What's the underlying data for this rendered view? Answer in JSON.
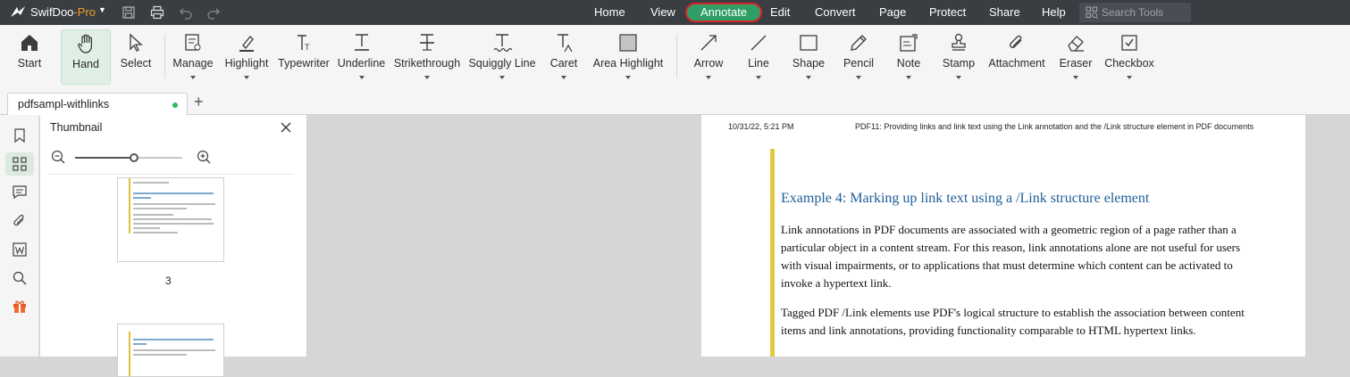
{
  "app": {
    "name": "SwifDoo",
    "edition": "-Pro"
  },
  "menu": {
    "items": [
      "Home",
      "View",
      "Annotate",
      "Edit",
      "Convert",
      "Page",
      "Protect",
      "Share",
      "Help"
    ],
    "active": "Annotate",
    "search_placeholder": "Search Tools"
  },
  "ribbon": {
    "tools": [
      {
        "label": "Start",
        "icon": "home-icon",
        "dropdown": false
      },
      {
        "label": "Hand",
        "icon": "hand-icon",
        "dropdown": false,
        "active": true
      },
      {
        "label": "Select",
        "icon": "cursor-icon",
        "dropdown": false
      },
      {
        "label": "Manage",
        "icon": "manage-icon",
        "dropdown": true
      },
      {
        "label": "Highlight",
        "icon": "highlighter-icon",
        "dropdown": true
      },
      {
        "label": "Typewriter",
        "icon": "typewriter-icon",
        "dropdown": false
      },
      {
        "label": "Underline",
        "icon": "underline-icon",
        "dropdown": true
      },
      {
        "label": "Strikethrough",
        "icon": "strikethrough-icon",
        "dropdown": true
      },
      {
        "label": "Squiggly Line",
        "icon": "squiggly-icon",
        "dropdown": true
      },
      {
        "label": "Caret",
        "icon": "caret-icon",
        "dropdown": true
      },
      {
        "label": "Area Highlight",
        "icon": "area-highlight-icon",
        "dropdown": true
      },
      {
        "label": "Arrow",
        "icon": "arrow-icon",
        "dropdown": true
      },
      {
        "label": "Line",
        "icon": "line-icon",
        "dropdown": true
      },
      {
        "label": "Shape",
        "icon": "shape-icon",
        "dropdown": true
      },
      {
        "label": "Pencil",
        "icon": "pencil-icon",
        "dropdown": true
      },
      {
        "label": "Note",
        "icon": "note-icon",
        "dropdown": true
      },
      {
        "label": "Stamp",
        "icon": "stamp-icon",
        "dropdown": true
      },
      {
        "label": "Attachment",
        "icon": "paperclip-icon",
        "dropdown": false
      },
      {
        "label": "Eraser",
        "icon": "eraser-icon",
        "dropdown": true
      },
      {
        "label": "Checkbox",
        "icon": "checkbox-icon",
        "dropdown": true
      }
    ]
  },
  "tabs": {
    "document": "pdfsampl-withlinks",
    "add": "+"
  },
  "panel": {
    "title": "Thumbnail",
    "zoom_level": 0.55,
    "page_number": "3"
  },
  "document": {
    "header_left": "10/31/22, 5:21 PM",
    "header_right": "PDF11: Providing links and link text using the Link annotation and the /Link structure element in PDF documents",
    "heading": "Example 4: Marking up link text using a /Link structure element",
    "paragraphs": [
      "Link annotations in PDF documents are associated with a geometric region of a page rather than a particular object in a content stream. For this reason, link annotations alone are not useful for users with visual impairments, or to applications that must determine which content can be activated to invoke a hypertext link.",
      "Tagged PDF /Link elements use PDF's logical structure to establish the association between content items and link annotations, providing functionality comparable to HTML hypertext links."
    ]
  },
  "colors": {
    "titlebar": "#3a3d42",
    "accent": "#2f9e65",
    "active_outline": "#d9262a",
    "heading": "#1f5d98",
    "highlight_bar": "#e3c844"
  }
}
